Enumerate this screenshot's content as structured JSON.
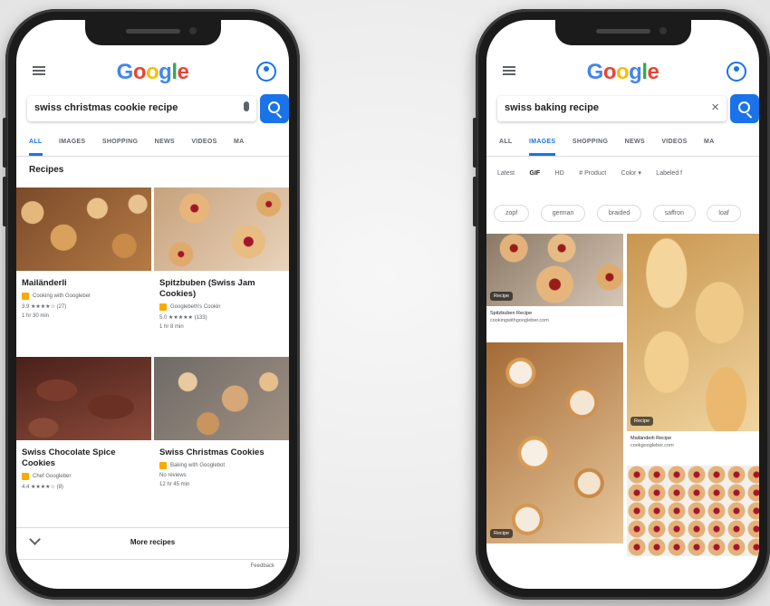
{
  "colors": {
    "accent": "#1a73e8",
    "star": "#f9ab00",
    "text": "#202124",
    "muted": "#5f6368"
  },
  "left": {
    "logo": [
      "G",
      "o",
      "o",
      "g",
      "l",
      "e"
    ],
    "logo_colors": [
      "#4285f4",
      "#ea4335",
      "#fbbc05",
      "#4285f4",
      "#34a853",
      "#ea4335"
    ],
    "query": "swiss christmas cookie recipe",
    "tabs": [
      "ALL",
      "IMAGES",
      "SHOPPING",
      "NEWS",
      "VIDEOS",
      "MA"
    ],
    "active_tab": "ALL",
    "section_title": "Recipes",
    "recipes": [
      {
        "title": "Mailänderli",
        "source": "Cooking with Googleber",
        "rating": "3.9 ★★★★☆ (27)",
        "meta": "1 hr 30 min"
      },
      {
        "title": "Spitzbuben (Swiss Jam Cookies)",
        "source": "Googlebeth's Cookin",
        "rating": "5.0 ★★★★★ (133)",
        "meta": "1 hr 8 min"
      },
      {
        "title": "Swiss Chocolate Spice Cookies",
        "source": "Chef Googleber",
        "rating": "4.4 ★★★★☆ (8)",
        "meta": ""
      },
      {
        "title": "Swiss Christmas Cookies",
        "source": "Baking with Googlebot",
        "rating": "No reviews",
        "meta": "12 hr 45 min"
      }
    ],
    "more_label": "More recipes",
    "feedback": "Feedback"
  },
  "right": {
    "logo": [
      "G",
      "o",
      "o",
      "g",
      "l",
      "e"
    ],
    "query": "swiss baking recipe",
    "tabs": [
      "ALL",
      "IMAGES",
      "SHOPPING",
      "NEWS",
      "VIDEOS",
      "MA"
    ],
    "active_tab": "IMAGES",
    "tools": [
      "Latest",
      "GIF",
      "HD",
      "# Product",
      "Color ▾",
      "Labeled f"
    ],
    "chips": [
      "zopf",
      "german",
      "braided",
      "saffron",
      "loaf"
    ],
    "images": [
      {
        "badge": "Recipe",
        "caption": "Spitzbuben Recipe",
        "domain": "cookingwithgoogleber.com"
      },
      {
        "badge": "Recipe",
        "caption": "Mailänderli Recipe",
        "domain": "cookgoogleber.com"
      },
      {
        "badge": "Recipe",
        "caption": "",
        "domain": ""
      },
      {
        "badge": "",
        "caption": "",
        "domain": ""
      }
    ]
  }
}
